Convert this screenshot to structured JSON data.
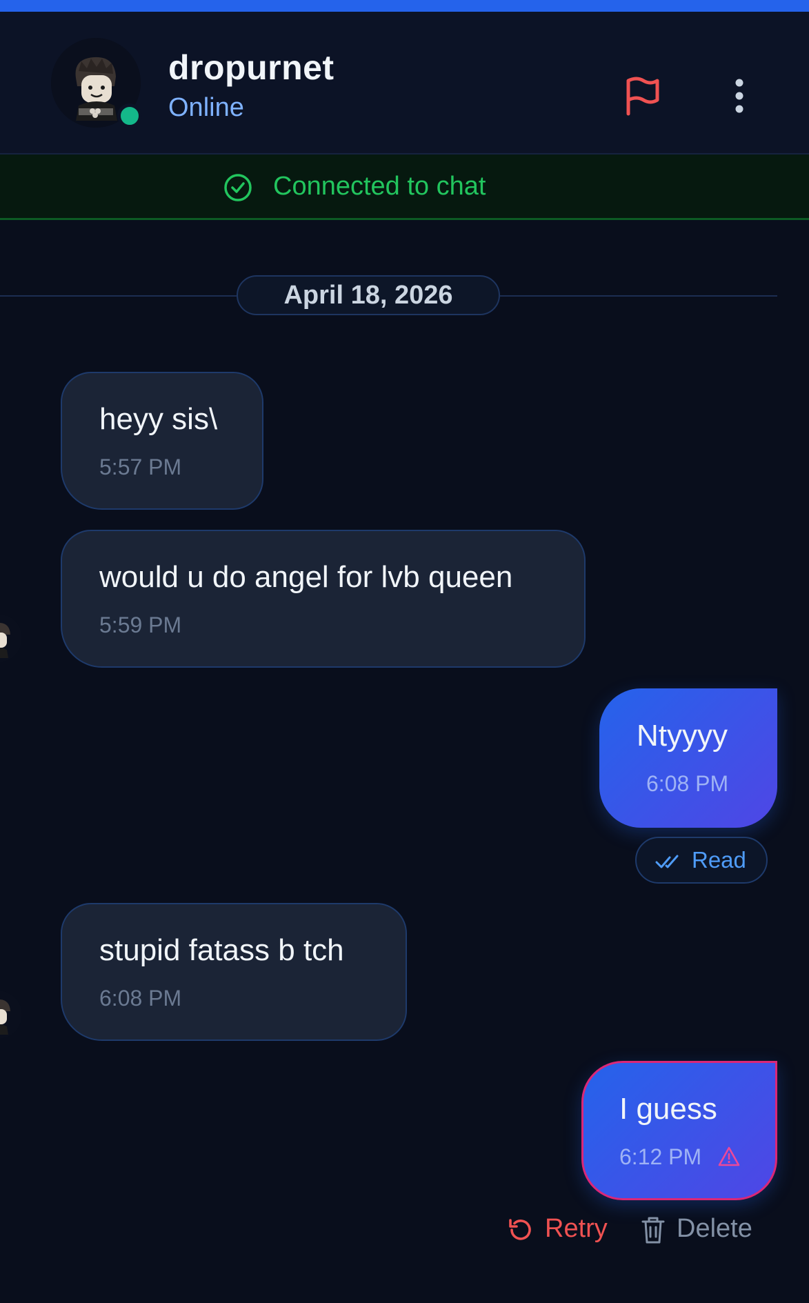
{
  "header": {
    "contact_name": "dropurnet",
    "status": "Online",
    "report_icon": "flag-icon",
    "menu_icon": "more-vertical-icon"
  },
  "connection_banner": {
    "icon": "check-circle-icon",
    "text": "Connected to chat"
  },
  "date_separator": "April 18, 2026",
  "messages": [
    {
      "direction": "incoming",
      "text": "heyy sis\\",
      "time": "5:57 PM"
    },
    {
      "direction": "incoming",
      "text": "would u do angel for lvb queen",
      "time": "5:59 PM"
    },
    {
      "direction": "outgoing",
      "text": "Ntyyyy",
      "time": "6:08 PM",
      "receipt": "Read",
      "receipt_icon": "double-check-icon"
    },
    {
      "direction": "incoming",
      "text": "stupid fatass b tch",
      "time": "6:08 PM"
    },
    {
      "direction": "outgoing",
      "text": "I guess",
      "time": "6:12 PM",
      "status": "failed",
      "status_icon": "warning-triangle-icon"
    }
  ],
  "failed_actions": {
    "retry_label": "Retry",
    "retry_icon": "retry-icon",
    "delete_label": "Delete",
    "delete_icon": "trash-icon"
  },
  "colors": {
    "accent": "#2563eb",
    "background": "#090e1c",
    "online": "#14b88a",
    "connected": "#22c55e",
    "error": "#f05252",
    "incoming_bubble": "#1b2436"
  }
}
